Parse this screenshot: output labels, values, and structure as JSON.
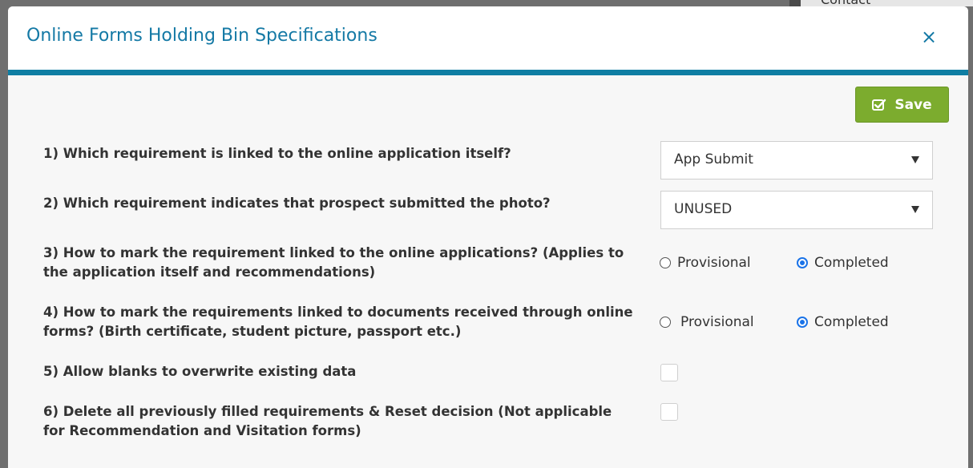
{
  "background": {
    "partial_text": "Contact"
  },
  "modal": {
    "title": "Online Forms Holding Bin Specifications",
    "close_label": "×",
    "save_label": "Save"
  },
  "questions": [
    {
      "label": "1) Which requirement is linked to the online application itself?",
      "type": "select",
      "value": "App Submit"
    },
    {
      "label": "2) Which requirement indicates that prospect submitted the photo?",
      "type": "select",
      "value": "UNUSED"
    },
    {
      "label": "3) How to mark the requirement linked to the online applications? (Applies to the application itself and recommendations)",
      "type": "radio",
      "options": [
        "Provisional",
        "Completed"
      ],
      "selected": "Completed"
    },
    {
      "label": "4) How to mark the requirements linked to documents received through online forms? (Birth certificate, student picture, passport etc.)",
      "type": "radio",
      "options": [
        "Provisional",
        "Completed"
      ],
      "selected": "Completed"
    },
    {
      "label": "5) Allow blanks to overwrite existing data",
      "type": "checkbox",
      "checked": false
    },
    {
      "label": "6) Delete all previously filled requirements & Reset decision (Not applicable for Recommendation and Visitation forms)",
      "type": "checkbox",
      "checked": false
    }
  ],
  "colors": {
    "accent": "#0f7ea3",
    "title": "#1479a5",
    "save": "#7cac2e",
    "radio": "#1a73e8"
  }
}
